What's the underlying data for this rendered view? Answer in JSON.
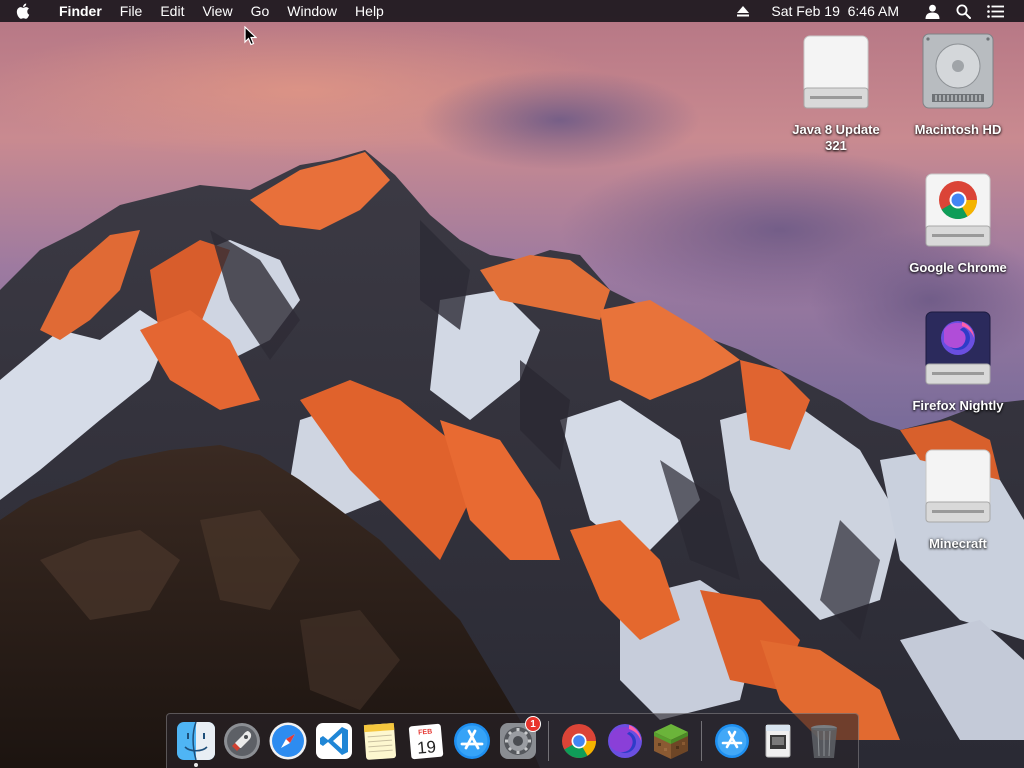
{
  "menubar": {
    "apple_icon": "apple-icon",
    "app_name": "Finder",
    "menus": [
      "File",
      "Edit",
      "View",
      "Go",
      "Window",
      "Help"
    ],
    "status_icons": [
      "eject-icon",
      "user-icon",
      "spotlight-search-icon",
      "notification-center-icon"
    ],
    "clock": "Sat Feb 19  6:46 AM"
  },
  "desktop": {
    "icons": [
      {
        "label": "Java 8 Update 321",
        "icon": "disk-image-icon"
      },
      {
        "label": "Macintosh HD",
        "icon": "hard-drive-icon"
      },
      {
        "label": "Google Chrome",
        "icon": "chrome-disk-icon"
      },
      {
        "label": "Firefox Nightly",
        "icon": "firefox-nightly-disk-icon"
      },
      {
        "label": "Minecraft",
        "icon": "disk-image-icon"
      }
    ]
  },
  "dock": {
    "items": [
      {
        "name": "Finder",
        "icon": "finder-icon",
        "running": true
      },
      {
        "name": "Launchpad",
        "icon": "launchpad-icon"
      },
      {
        "name": "Safari",
        "icon": "safari-icon"
      },
      {
        "name": "Visual Studio Code",
        "icon": "vscode-icon"
      },
      {
        "name": "Notes",
        "icon": "notes-icon"
      },
      {
        "name": "Calendar",
        "icon": "calendar-icon",
        "calendar_month": "FEB",
        "calendar_day": "19"
      },
      {
        "name": "App Store",
        "icon": "app-store-icon"
      },
      {
        "name": "System Preferences",
        "icon": "system-preferences-icon",
        "badge": "1"
      },
      {
        "name": "Google Chrome",
        "icon": "chrome-icon"
      },
      {
        "name": "Firefox Nightly",
        "icon": "firefox-nightly-icon"
      },
      {
        "name": "Minecraft",
        "icon": "minecraft-icon"
      },
      {
        "name": "Applications",
        "icon": "applications-folder-icon"
      },
      {
        "name": "Downloads",
        "icon": "downloads-stack-icon"
      },
      {
        "name": "Trash",
        "icon": "trash-icon"
      }
    ]
  },
  "colors": {
    "menubar_bg": "#1c181e",
    "text": "#ffffff",
    "badge": "#e8352d",
    "sky_top": "#c47a86",
    "sky_mid": "#8a6b98",
    "alpenglow": "#e8622a"
  }
}
